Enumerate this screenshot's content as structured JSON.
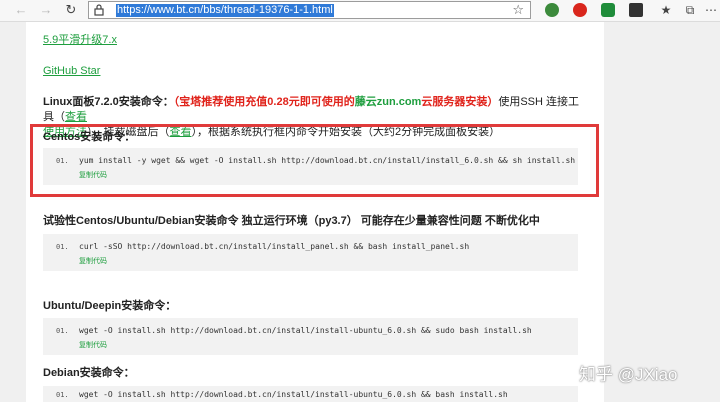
{
  "browser": {
    "url": "https://www.bt.cn/bbs/thread-19376-1-1.html"
  },
  "page": {
    "link_upgrade": "5.9平滑升级7.x",
    "link_github": "GitHub Star",
    "linux_title": "Linux面板7.2.0安装命令：",
    "promo_open": "（宝塔推荐使用充值0.28元即可使用的",
    "promo_brand": "藤云zun.com",
    "promo_close": "云服务器安装）",
    "ssh_text": "使用SSH 连接工具（",
    "ssh_link": "查看",
    "line2_link1": "使用方法",
    "line2_mid": "），挂载磁盘后（",
    "line2_link2": "查看",
    "line2_tail": "），根据系统执行框内命令开始安装（大约2分钟完成面板安装）",
    "sections": [
      {
        "title": "Centos安装命令：",
        "line_no": "01.",
        "code": "yum install -y wget && wget -O install.sh http://download.bt.cn/install/install_6.0.sh && sh install.sh",
        "copy": "复制代码"
      },
      {
        "title": "试验性Centos/Ubuntu/Debian安装命令 独立运行环境（py3.7） 可能存在少量兼容性问题 不断优化中",
        "line_no": "01.",
        "code": "curl -sSO http://download.bt.cn/install/install_panel.sh && bash install_panel.sh",
        "copy": "复制代码"
      },
      {
        "title": "Ubuntu/Deepin安装命令：",
        "line_no": "01.",
        "code": "wget -O install.sh http://download.bt.cn/install/install-ubuntu_6.0.sh && sudo bash install.sh",
        "copy": "复制代码"
      },
      {
        "title": "Debian安装命令：",
        "line_no": "01.",
        "code": "wget -O install.sh http://download.bt.cn/install/install-ubuntu_6.0.sh && bash install.sh",
        "copy": ""
      }
    ]
  },
  "watermark": "知乎 @JXiao",
  "icons": {
    "back": "back-arrow-icon",
    "forward": "forward-arrow-icon",
    "refresh": "refresh-icon",
    "lock": "lock-icon",
    "star": "star-icon"
  },
  "colors": {
    "link_green": "#1e9e3e",
    "promo_red": "#e0231b",
    "highlight_red": "#e03a3a",
    "url_selection": "#2f7ad8"
  }
}
